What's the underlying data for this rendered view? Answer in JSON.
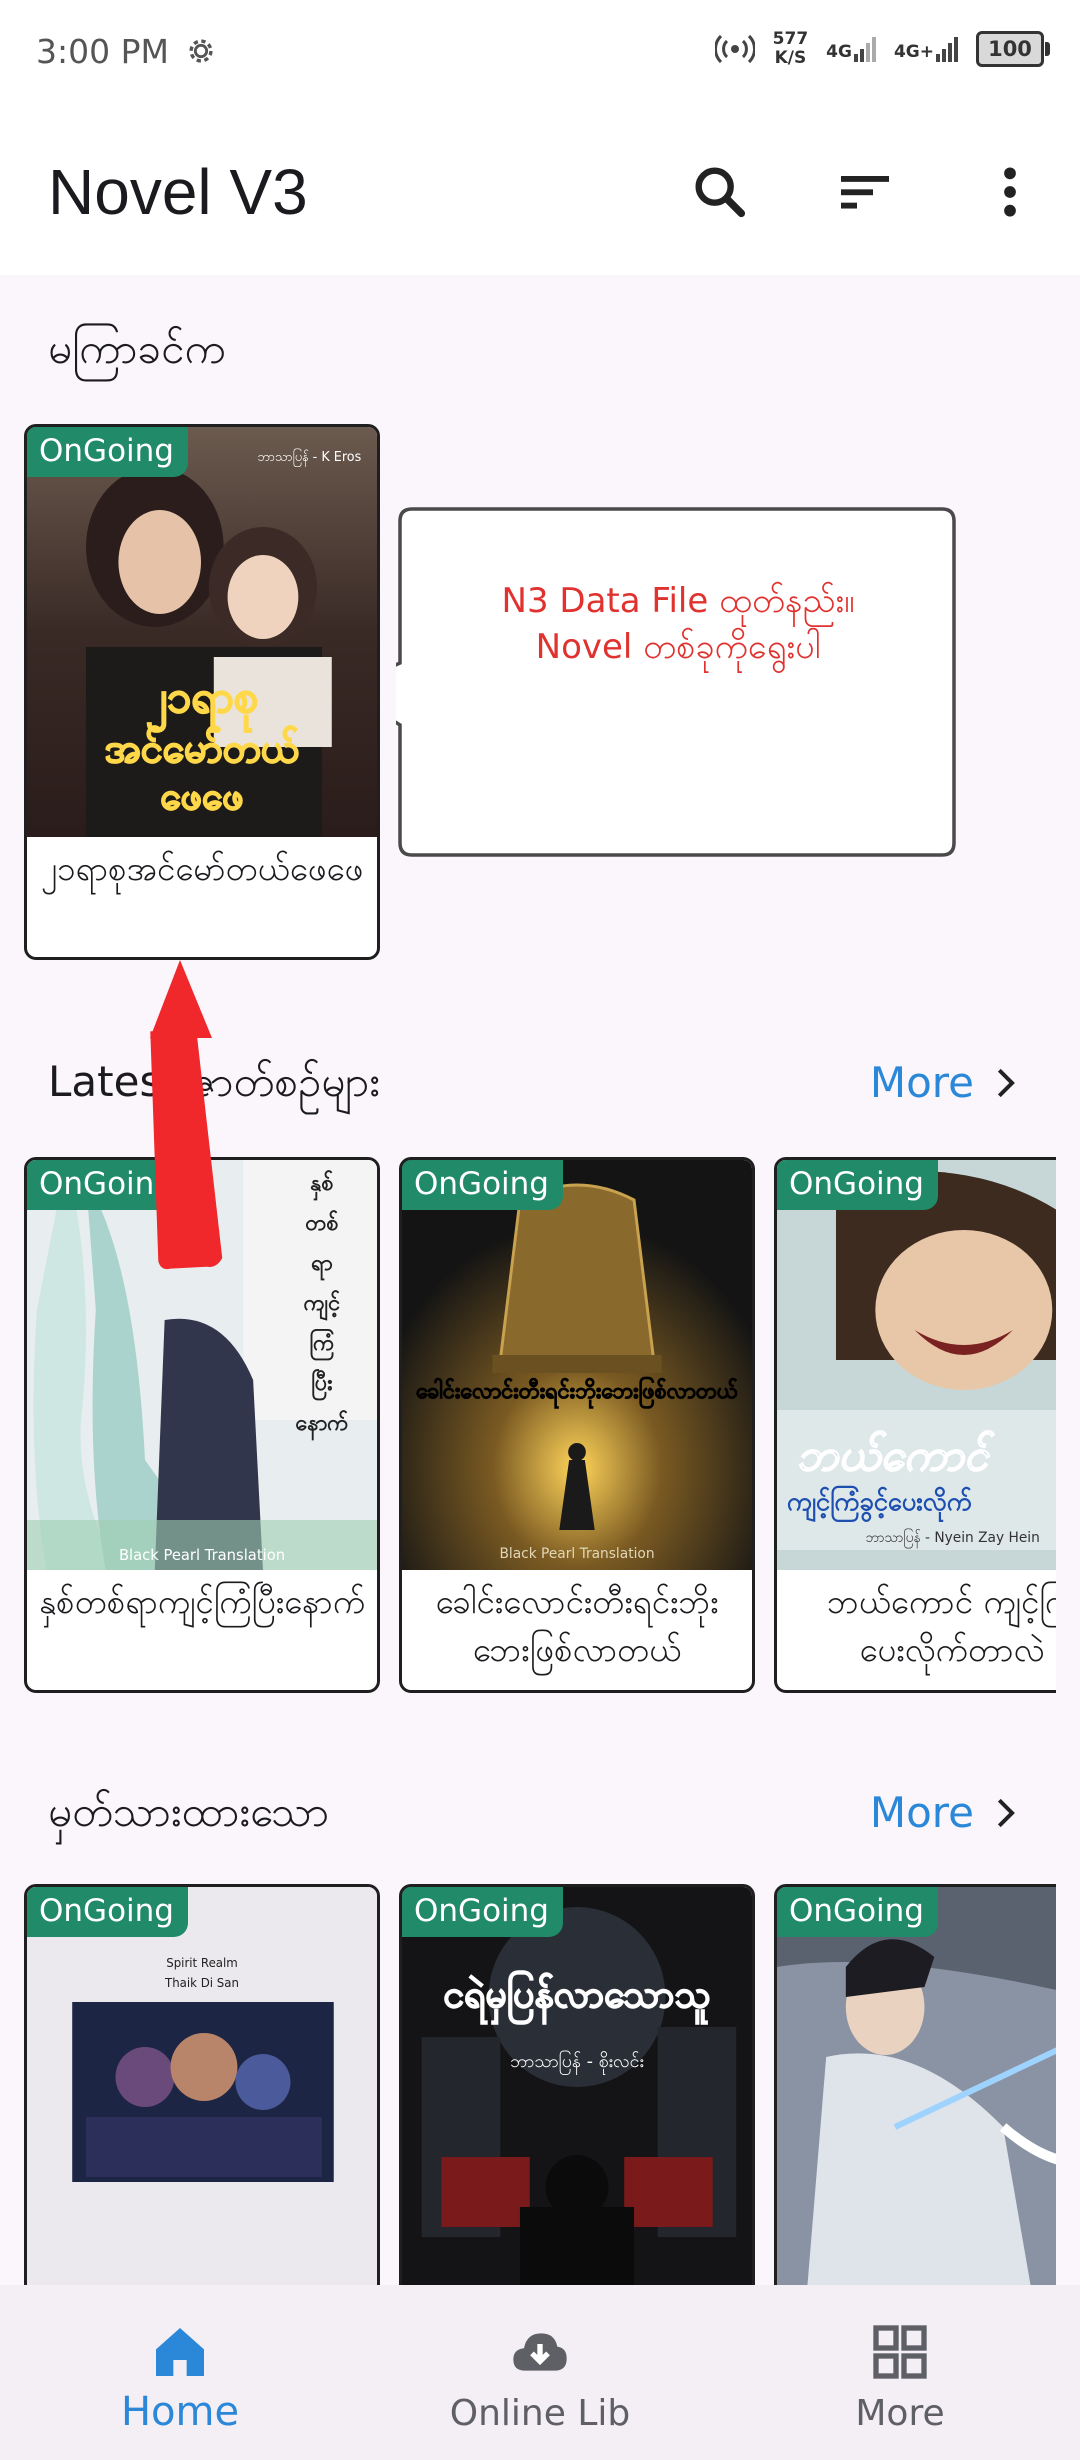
{
  "status_bar": {
    "time": "3:00 PM",
    "speed_value": "577",
    "speed_unit": "K/S",
    "net1": "4G",
    "net2": "4G+",
    "battery": "100"
  },
  "app_bar": {
    "title": "Novel V3",
    "icons": [
      "search-icon",
      "sort-icon",
      "more-vert-icon"
    ]
  },
  "recent": {
    "title": "မကြာခင်က",
    "items": [
      {
        "badge": "OnGoing",
        "caption": "၂၁ရာစုအင်မော်တယ်ဖေဖေ",
        "cover_title": "၂၁ရာစုအင်မော်တယ်ဖေဖေ",
        "cover_author": "ဘာသာပြန် - K Eros"
      }
    ]
  },
  "callout": {
    "line1": "N3 Data File ထုတ်နည်း။",
    "line2": "Novel တစ်ခုကိုရွေးပါ"
  },
  "latest": {
    "title": "Latest ဇာတ်စဥ်များ",
    "more_label": "More",
    "items": [
      {
        "badge": "OnGoing",
        "caption": "နှစ်တစ်ရာကျင့်ကြံပြီးနောက်",
        "cover_title": "နှစ်တစ်ရာကျင့်ကြံပြီးနောက်",
        "cover_footer": "Black Pearl Translation"
      },
      {
        "badge": "OnGoing",
        "caption": "ခေါင်းလောင်းတီးရင်းဘိုးဘေးဖြစ်လာတယ်",
        "cover_title": "ခေါင်းလောင်းတီးရင်းဘိုးဘေးဖြစ်လာတယ်",
        "cover_footer": "Black Pearl Translation"
      },
      {
        "badge": "OnGoing",
        "caption": "ဘယ်ကောင် ကျင့်ကြံ ပေးလိုက်တာလဲ",
        "cover_title": "ဘယ်ကောင် ကျင့်ကြံခွင့်ပေးလိုက်တာလဲ",
        "cover_footer": "ဘာသာပြန် - Nyein Zay Hein"
      }
    ]
  },
  "bookmarked": {
    "title": "မှတ်သားထားသော",
    "more_label": "More",
    "items": [
      {
        "badge": "OnGoing",
        "caption": "",
        "cover_title": "Spirit Realm",
        "cover_author": "Thaik Di San"
      },
      {
        "badge": "OnGoing",
        "caption": "",
        "cover_title": "ငရဲမှပြန်လာသောသူ",
        "cover_author": "ဘာသာပြန် - စိုးလင်း"
      },
      {
        "badge": "OnGoing",
        "caption": "",
        "cover_title": "",
        "cover_author": ""
      }
    ]
  },
  "bottom_nav": {
    "items": [
      {
        "label": "Home",
        "icon": "home-icon",
        "active": true
      },
      {
        "label": "Online Lib",
        "icon": "cloud-download-icon",
        "active": false
      },
      {
        "label": "More",
        "icon": "grid-icon",
        "active": false
      }
    ]
  },
  "colors": {
    "accent": "#2b88d8",
    "badge": "#218a68",
    "callout_text": "#e0322f",
    "arrow": "#f0282c"
  }
}
